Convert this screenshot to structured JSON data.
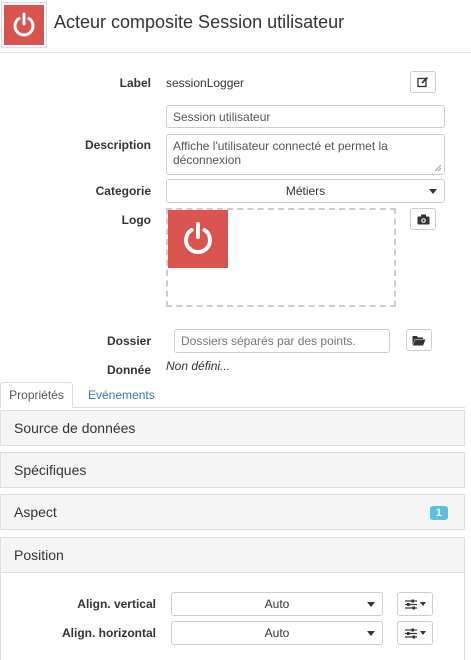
{
  "header": {
    "title": "Acteur composite Session utilisateur",
    "icon": "power-icon",
    "icon_bg": "#d9534f"
  },
  "form": {
    "label_label": "Label",
    "label_value": "sessionLogger",
    "title_value": "Session utilisateur",
    "description_label": "Description",
    "description_value": "Affiche l'utilisateur connecté et permet la déconnexion",
    "categorie_label": "Categorie",
    "categorie_value": "Métiers",
    "logo_label": "Logo",
    "dossier_label": "Dossier",
    "dossier_placeholder": "Dossiers séparés par des points.",
    "donnee_label": "Donnée",
    "donnee_value": "Non défini..."
  },
  "tabs": [
    {
      "label": "Propriétés",
      "active": true
    },
    {
      "label": "Evénements",
      "active": false
    }
  ],
  "panels": [
    {
      "label": "Source de données"
    },
    {
      "label": "Spécifiques"
    },
    {
      "label": "Aspect",
      "badge": "1"
    },
    {
      "label": "Position"
    }
  ],
  "position": {
    "vertical_label": "Align. vertical",
    "vertical_value": "Auto",
    "horizontal_label": "Align. horizontal",
    "horizontal_value": "Auto"
  },
  "colors": {
    "accent": "#d9534f",
    "link": "#337ab7",
    "badge": "#5bc0de"
  }
}
